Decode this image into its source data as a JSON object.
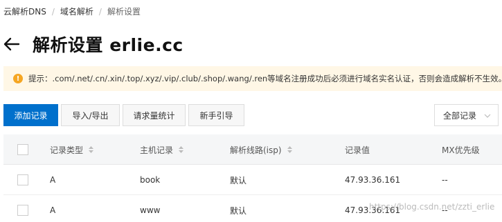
{
  "breadcrumb": {
    "items": [
      "云解析DNS",
      "域名解析",
      "解析设置"
    ]
  },
  "header": {
    "title": "解析设置 erlie.cc"
  },
  "notice": {
    "text": "提示：.com/.net/.cn/.xin/.top/.xyz/.vip/.club/.shop/.wang/.ren等域名注册成功后必须进行域名实名认证，否则会造成解析不生效。"
  },
  "toolbar": {
    "add_label": "添加记录",
    "import_label": "导入/导出",
    "stats_label": "请求量统计",
    "guide_label": "新手引导",
    "filter_label": "全部记录"
  },
  "table": {
    "columns": [
      "记录类型",
      "主机记录",
      "解析线路(isp)",
      "记录值",
      "MX优先级"
    ],
    "rows": [
      {
        "type": "A",
        "host": "book",
        "line": "默认",
        "value": "47.93.36.161",
        "mx": "--"
      },
      {
        "type": "A",
        "host": "www",
        "line": "默认",
        "value": "47.93.36.161",
        "mx": "--"
      }
    ]
  },
  "watermark": "https://blog.csdn.net/zzti_erlie",
  "colors": {
    "primary": "#0070cc",
    "notice_bg": "#fff7e6",
    "notice_icon": "#f5a623",
    "header_bg": "#f5f6f7"
  }
}
